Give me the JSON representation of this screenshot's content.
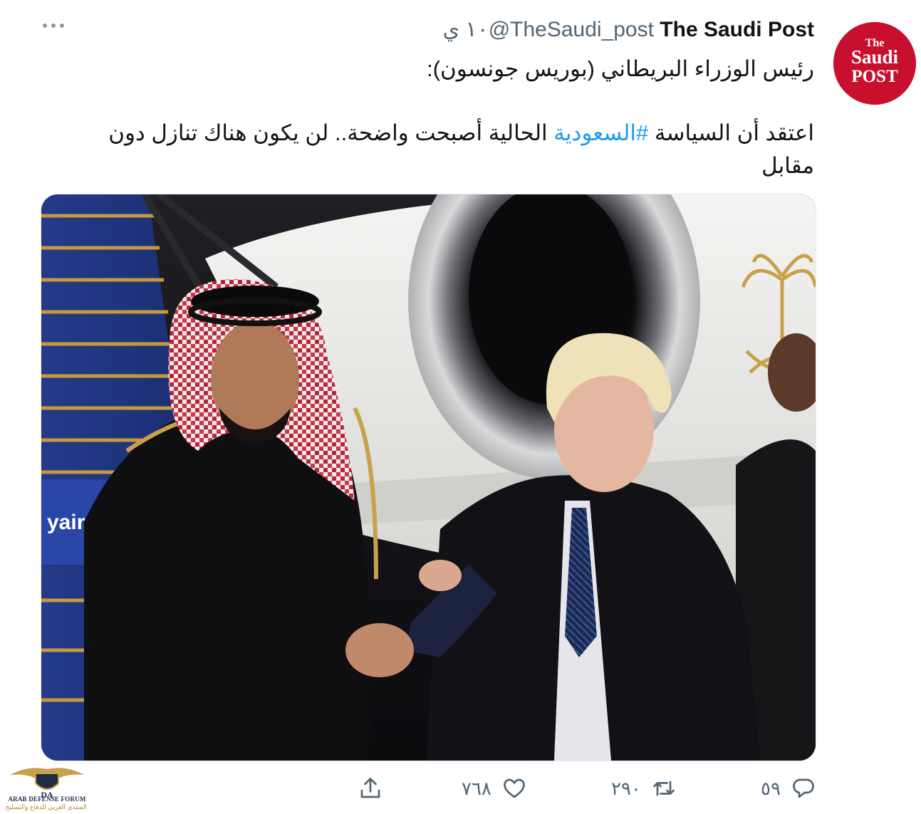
{
  "tweet": {
    "display_name": "The Saudi Post",
    "handle": "@TheSaudi_post",
    "timestamp": "١٠ ي",
    "line1": "رئيس الوزراء البريطاني (بوريس جونسون):",
    "line2_before": "اعتقد أن السياسة ",
    "hashtag": "#السعودية",
    "line2_after": " الحالية أصبحت واضحة.. لن يكون هناك تنازل دون مقابل"
  },
  "avatar": {
    "the": "The",
    "saudi": "Saudi",
    "post": "POST",
    "color": "#c8102e"
  },
  "photo": {
    "airline_text": "yair"
  },
  "actions": {
    "reply_count": "٥٩",
    "retweet_count": "٢٩٠",
    "like_count": "٧٦٨"
  },
  "icons": {
    "more": "more-horizontal-icon",
    "reply": "reply-icon",
    "retweet": "retweet-icon",
    "like": "heart-icon",
    "share": "share-icon"
  },
  "watermark": {
    "logo_letters": "DA",
    "name_en": "ARAB DEFENSE FORUM",
    "name_ar": "المنتدى العربي للدفاع والتسليح"
  },
  "colors": {
    "link": "#1d9bf0",
    "muted": "#536471",
    "text": "#0f1419"
  }
}
